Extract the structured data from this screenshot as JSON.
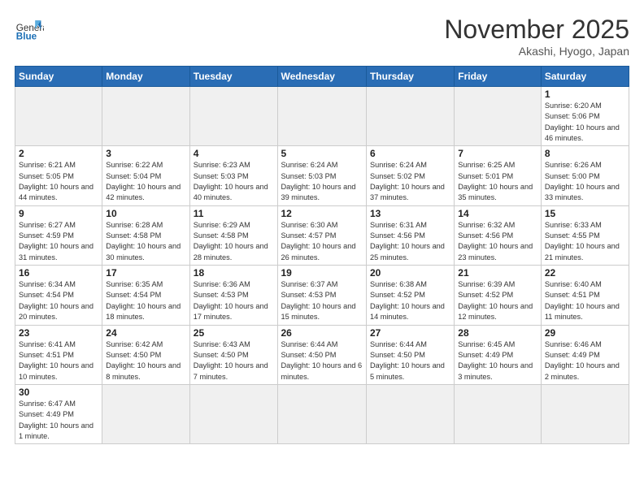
{
  "header": {
    "logo_general": "General",
    "logo_blue": "Blue",
    "month": "November 2025",
    "location": "Akashi, Hyogo, Japan"
  },
  "days_of_week": [
    "Sunday",
    "Monday",
    "Tuesday",
    "Wednesday",
    "Thursday",
    "Friday",
    "Saturday"
  ],
  "weeks": [
    [
      {
        "day": "",
        "info": ""
      },
      {
        "day": "",
        "info": ""
      },
      {
        "day": "",
        "info": ""
      },
      {
        "day": "",
        "info": ""
      },
      {
        "day": "",
        "info": ""
      },
      {
        "day": "",
        "info": ""
      },
      {
        "day": "1",
        "info": "Sunrise: 6:20 AM\nSunset: 5:06 PM\nDaylight: 10 hours\nand 46 minutes."
      }
    ],
    [
      {
        "day": "2",
        "info": "Sunrise: 6:21 AM\nSunset: 5:05 PM\nDaylight: 10 hours\nand 44 minutes."
      },
      {
        "day": "3",
        "info": "Sunrise: 6:22 AM\nSunset: 5:04 PM\nDaylight: 10 hours\nand 42 minutes."
      },
      {
        "day": "4",
        "info": "Sunrise: 6:23 AM\nSunset: 5:03 PM\nDaylight: 10 hours\nand 40 minutes."
      },
      {
        "day": "5",
        "info": "Sunrise: 6:24 AM\nSunset: 5:03 PM\nDaylight: 10 hours\nand 39 minutes."
      },
      {
        "day": "6",
        "info": "Sunrise: 6:24 AM\nSunset: 5:02 PM\nDaylight: 10 hours\nand 37 minutes."
      },
      {
        "day": "7",
        "info": "Sunrise: 6:25 AM\nSunset: 5:01 PM\nDaylight: 10 hours\nand 35 minutes."
      },
      {
        "day": "8",
        "info": "Sunrise: 6:26 AM\nSunset: 5:00 PM\nDaylight: 10 hours\nand 33 minutes."
      }
    ],
    [
      {
        "day": "9",
        "info": "Sunrise: 6:27 AM\nSunset: 4:59 PM\nDaylight: 10 hours\nand 31 minutes."
      },
      {
        "day": "10",
        "info": "Sunrise: 6:28 AM\nSunset: 4:58 PM\nDaylight: 10 hours\nand 30 minutes."
      },
      {
        "day": "11",
        "info": "Sunrise: 6:29 AM\nSunset: 4:58 PM\nDaylight: 10 hours\nand 28 minutes."
      },
      {
        "day": "12",
        "info": "Sunrise: 6:30 AM\nSunset: 4:57 PM\nDaylight: 10 hours\nand 26 minutes."
      },
      {
        "day": "13",
        "info": "Sunrise: 6:31 AM\nSunset: 4:56 PM\nDaylight: 10 hours\nand 25 minutes."
      },
      {
        "day": "14",
        "info": "Sunrise: 6:32 AM\nSunset: 4:56 PM\nDaylight: 10 hours\nand 23 minutes."
      },
      {
        "day": "15",
        "info": "Sunrise: 6:33 AM\nSunset: 4:55 PM\nDaylight: 10 hours\nand 21 minutes."
      }
    ],
    [
      {
        "day": "16",
        "info": "Sunrise: 6:34 AM\nSunset: 4:54 PM\nDaylight: 10 hours\nand 20 minutes."
      },
      {
        "day": "17",
        "info": "Sunrise: 6:35 AM\nSunset: 4:54 PM\nDaylight: 10 hours\nand 18 minutes."
      },
      {
        "day": "18",
        "info": "Sunrise: 6:36 AM\nSunset: 4:53 PM\nDaylight: 10 hours\nand 17 minutes."
      },
      {
        "day": "19",
        "info": "Sunrise: 6:37 AM\nSunset: 4:53 PM\nDaylight: 10 hours\nand 15 minutes."
      },
      {
        "day": "20",
        "info": "Sunrise: 6:38 AM\nSunset: 4:52 PM\nDaylight: 10 hours\nand 14 minutes."
      },
      {
        "day": "21",
        "info": "Sunrise: 6:39 AM\nSunset: 4:52 PM\nDaylight: 10 hours\nand 12 minutes."
      },
      {
        "day": "22",
        "info": "Sunrise: 6:40 AM\nSunset: 4:51 PM\nDaylight: 10 hours\nand 11 minutes."
      }
    ],
    [
      {
        "day": "23",
        "info": "Sunrise: 6:41 AM\nSunset: 4:51 PM\nDaylight: 10 hours\nand 10 minutes."
      },
      {
        "day": "24",
        "info": "Sunrise: 6:42 AM\nSunset: 4:50 PM\nDaylight: 10 hours\nand 8 minutes."
      },
      {
        "day": "25",
        "info": "Sunrise: 6:43 AM\nSunset: 4:50 PM\nDaylight: 10 hours\nand 7 minutes."
      },
      {
        "day": "26",
        "info": "Sunrise: 6:44 AM\nSunset: 4:50 PM\nDaylight: 10 hours\nand 6 minutes."
      },
      {
        "day": "27",
        "info": "Sunrise: 6:44 AM\nSunset: 4:50 PM\nDaylight: 10 hours\nand 5 minutes."
      },
      {
        "day": "28",
        "info": "Sunrise: 6:45 AM\nSunset: 4:49 PM\nDaylight: 10 hours\nand 3 minutes."
      },
      {
        "day": "29",
        "info": "Sunrise: 6:46 AM\nSunset: 4:49 PM\nDaylight: 10 hours\nand 2 minutes."
      }
    ],
    [
      {
        "day": "30",
        "info": "Sunrise: 6:47 AM\nSunset: 4:49 PM\nDaylight: 10 hours\nand 1 minute."
      },
      {
        "day": "",
        "info": ""
      },
      {
        "day": "",
        "info": ""
      },
      {
        "day": "",
        "info": ""
      },
      {
        "day": "",
        "info": ""
      },
      {
        "day": "",
        "info": ""
      },
      {
        "day": "",
        "info": ""
      }
    ]
  ]
}
